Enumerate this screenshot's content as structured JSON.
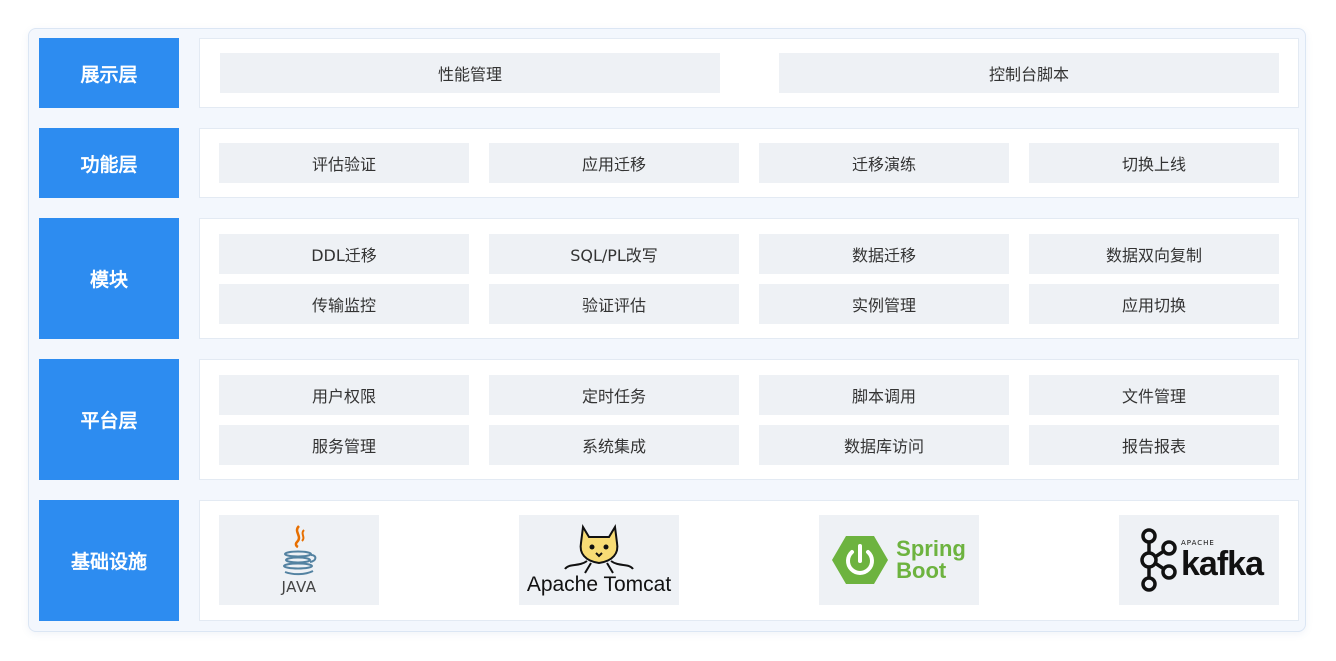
{
  "colors": {
    "label_bg": "#2d8cf0",
    "cell_bg": "#eef1f5",
    "spring_green": "#6db33f"
  },
  "layers": {
    "presentation": {
      "label": "展示层",
      "items": [
        "性能管理",
        "控制台脚本"
      ]
    },
    "function": {
      "label": "功能层",
      "items": [
        "评估验证",
        "应用迁移",
        "迁移演练",
        "切换上线"
      ]
    },
    "module": {
      "label": "模块",
      "items": [
        "DDL迁移",
        "SQL/PL改写",
        "数据迁移",
        "数据双向复制",
        "传输监控",
        "验证评估",
        "实例管理",
        "应用切换"
      ]
    },
    "platform": {
      "label": "平台层",
      "items": [
        "用户权限",
        "定时任务",
        "脚本调用",
        "文件管理",
        "服务管理",
        "系统集成",
        "数据库访问",
        "报告报表"
      ]
    },
    "infrastructure": {
      "label": "基础设施",
      "java": "JAVA",
      "tomcat": "Apache Tomcat",
      "spring": [
        "Spring",
        "Boot"
      ],
      "kafka": {
        "small": "APACHE",
        "word": "kafka"
      }
    }
  }
}
